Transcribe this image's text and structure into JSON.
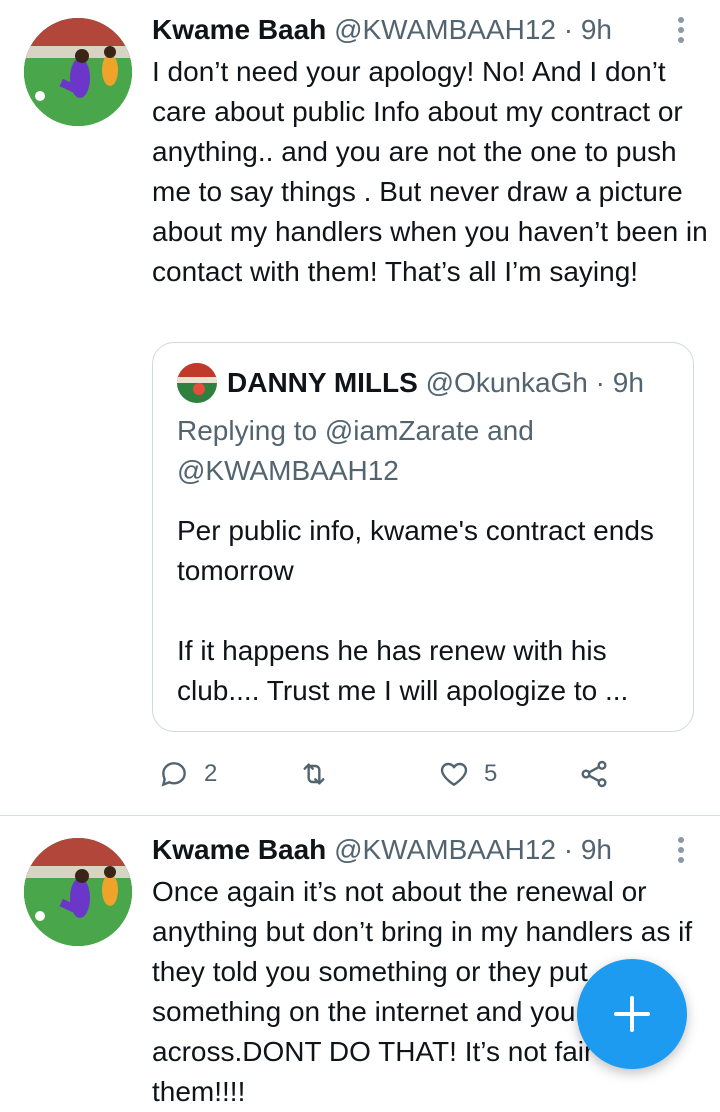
{
  "tweets": [
    {
      "author_name": "Kwame Baah",
      "handle": "@KWAMBAAH12",
      "separator": "·",
      "time": "9h",
      "text": "I don’t need your apology! No! And I don’t care about public Info about my contract or anything.. and you are not the one to push me to say things . But never draw a picture about my handlers when you haven’t been in contact with them! That’s all I’m saying!",
      "quote": {
        "author_name": "DANNY MILLS",
        "handle": "@OkunkaGh",
        "separator": "·",
        "time": "9h",
        "replying_to": "Replying to @iamZarate and @KWAMBAAH12",
        "text": "Per public info, kwame's contract ends tomorrow\n\nIf it happens he has renew with his club.... Trust me I will apologize to ..."
      },
      "actions": {
        "reply_count": "2",
        "retweet_count": "",
        "like_count": "5"
      }
    },
    {
      "author_name": "Kwame Baah",
      "handle": "@KWAMBAAH12",
      "separator": "·",
      "time": "9h",
      "text": "Once again it’s not about the renewal or anything but don’t bring in my handlers as if they told you something or they put something on the internet and you came across.DONT DO THAT! It’s not fair on them!!!!"
    }
  ],
  "colors": {
    "accent": "#1d9bf0",
    "muted": "#536471",
    "border": "#cfd9de"
  },
  "icons": {
    "reply": "reply-icon",
    "retweet": "retweet-icon",
    "like": "heart-icon",
    "share": "share-icon",
    "compose": "plus-icon",
    "more": "more-vertical-icon"
  }
}
